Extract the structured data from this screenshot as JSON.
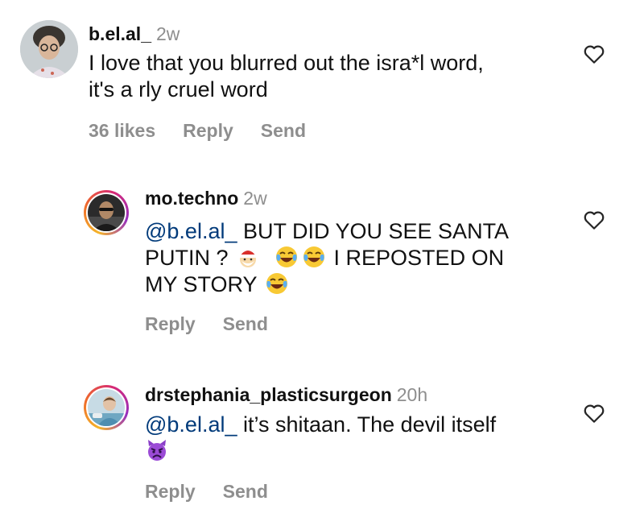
{
  "comments": [
    {
      "username": "b.el.al_",
      "time": "2w",
      "text_line1": "I love that you blurred out the isra*l word,",
      "text_line2": "it's a rly cruel word",
      "likes": "36 likes",
      "reply": "Reply",
      "send": "Send"
    },
    {
      "username": "mo.techno",
      "time": "2w",
      "mention": "@b.el.al_",
      "text_line1": " BUT DID YOU SEE SANTA",
      "text_line2a": "PUTIN ? ",
      "text_line2b": " I REPOSTED ON",
      "text_line3": "MY STORY ",
      "reply": "Reply",
      "send": "Send"
    },
    {
      "username": "drstephania_plasticsurgeon",
      "time": "20h",
      "mention": "@b.el.al_",
      "text_line1": " it’s shitaan. The devil itself",
      "reply": "Reply",
      "send": "Send"
    }
  ],
  "icons": {
    "heart": "heart-outline-icon",
    "santa_emoji": "santa-emoji-icon",
    "laughing_emoji": "face-with-tears-of-joy-icon",
    "devil_emoji": "angry-devil-emoji-icon"
  },
  "colors": {
    "mention": "#003a7a",
    "secondary_text": "#8e8e8e"
  }
}
